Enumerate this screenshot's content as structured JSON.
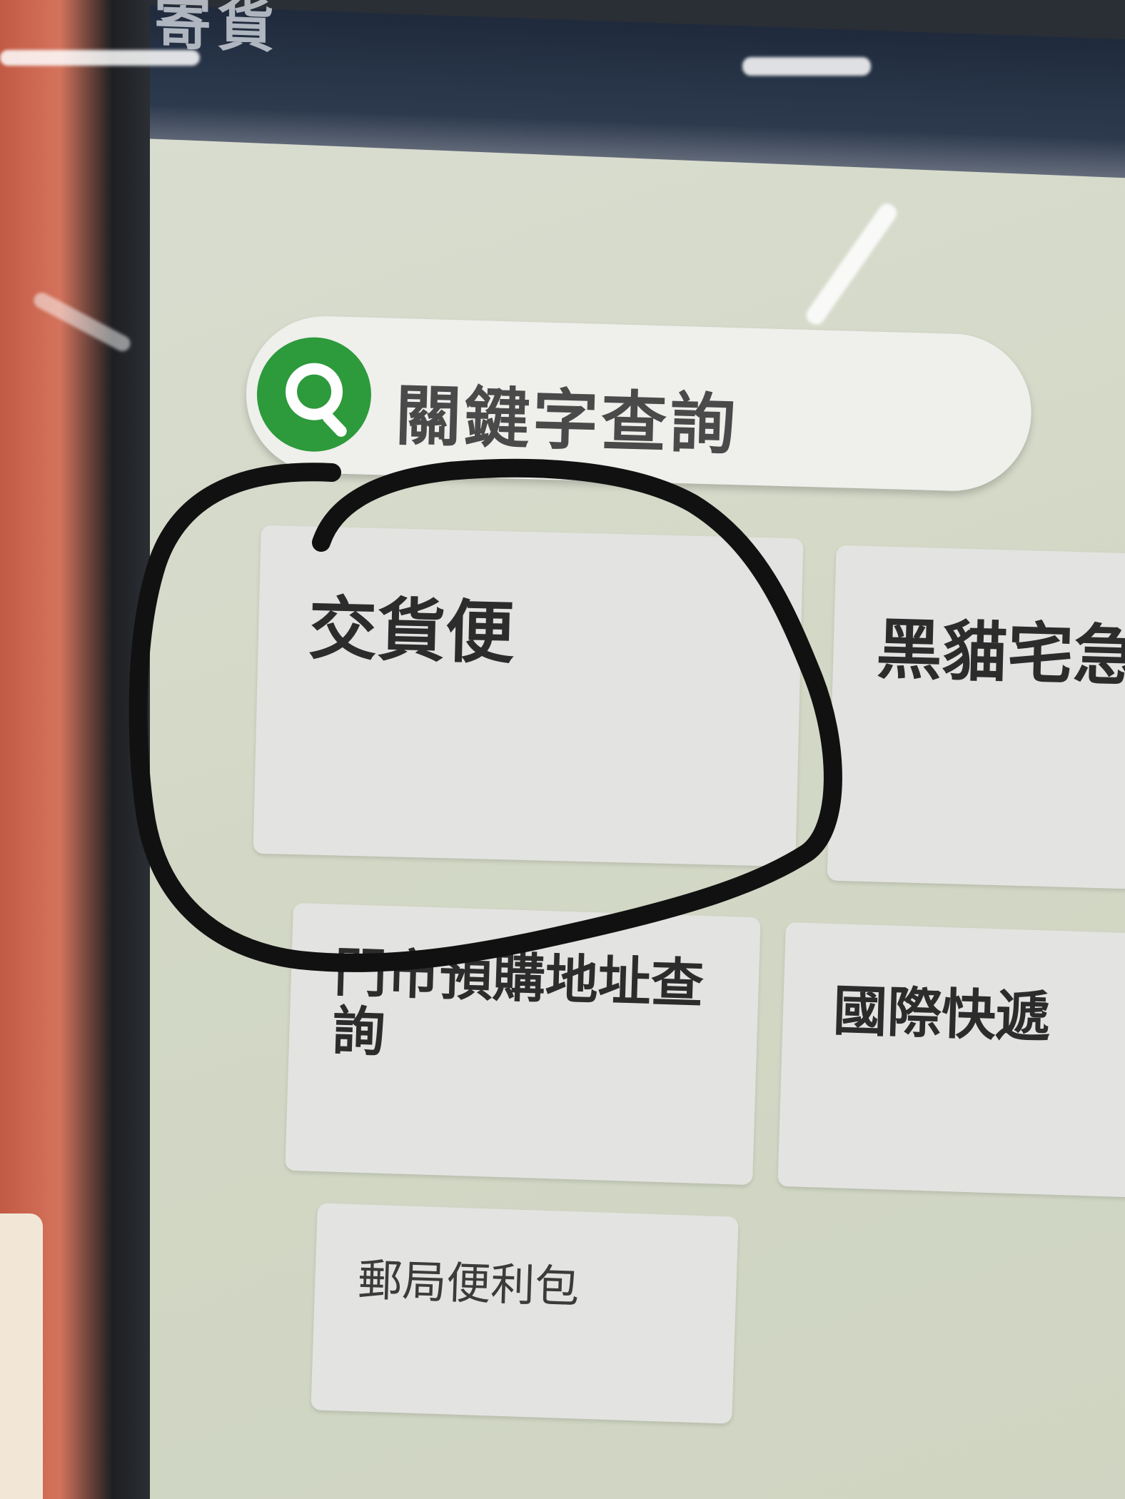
{
  "header": {
    "title": "郵局寄貨"
  },
  "search": {
    "placeholder": "關鍵字查詢",
    "icon": "search-icon",
    "accent_color": "#2d9a3b"
  },
  "tiles": [
    {
      "label": "交貨便"
    },
    {
      "label": "黑貓宅急"
    },
    {
      "label": "門市預購地址查詢"
    },
    {
      "label": "國際快遞"
    },
    {
      "label": "郵局便利包"
    }
  ],
  "annotation": {
    "stroke_color": "#111111"
  }
}
